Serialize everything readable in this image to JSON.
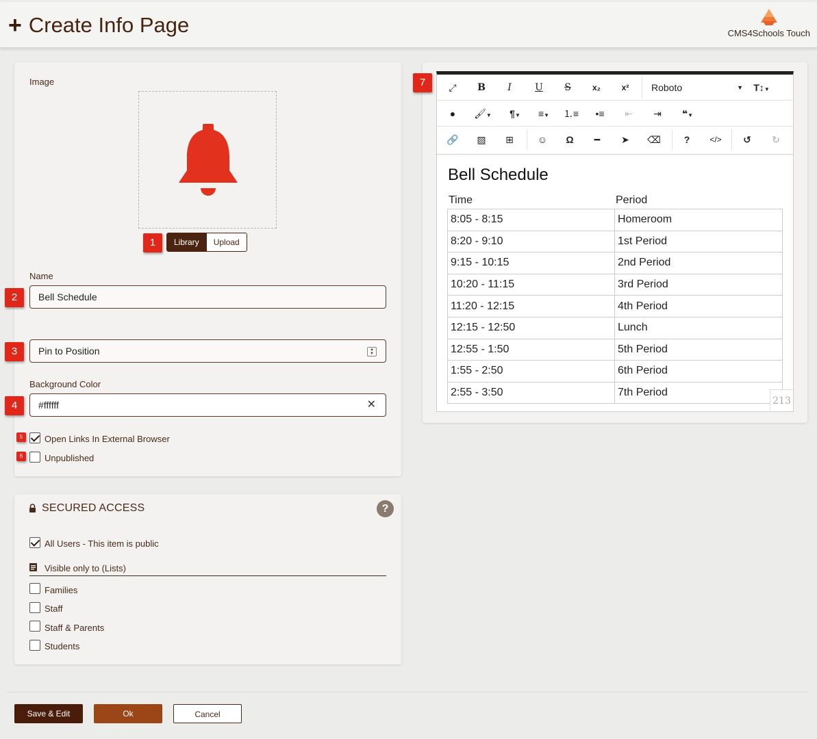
{
  "header": {
    "title": "Create Info Page",
    "brand": "CMS4Schools Touch"
  },
  "colors": {
    "accent": "#4a2410",
    "marker": "#e0271a",
    "bell": "#e2311c"
  },
  "form": {
    "image_label": "Image",
    "image_icon": "bell-icon",
    "library_label": "Library",
    "upload_label": "Upload",
    "name_label": "Name",
    "name_value": "Bell Schedule",
    "position_value": "Pin to Position",
    "bg_label": "Background Color",
    "bg_value": "#ffffff",
    "open_links_label": "Open Links In External Browser",
    "open_links_checked": true,
    "unpublished_label": "Unpublished",
    "unpublished_checked": false
  },
  "markers": [
    "1",
    "2",
    "3",
    "4",
    "5",
    "6",
    "7"
  ],
  "secured": {
    "title": "SECURED ACCESS",
    "help": "?",
    "all_users_label": "All Users - This item is public",
    "visible_label": "Visible only to (Lists)",
    "lists": [
      "Families",
      "Staff",
      "Staff & Parents",
      "Students"
    ]
  },
  "editor": {
    "font": "Roboto",
    "doc_title": "Bell Schedule",
    "col_time": "Time",
    "col_period": "Period",
    "rows": [
      [
        "8:05 - 8:15",
        "Homeroom"
      ],
      [
        "8:20 - 9:10",
        "1st Period"
      ],
      [
        "9:15 - 10:15",
        "2nd Period"
      ],
      [
        "10:20 - 11:15",
        "3rd Period"
      ],
      [
        "11:20 - 12:15",
        "4th Period"
      ],
      [
        "12:15 - 12:50",
        "Lunch"
      ],
      [
        "12:55 - 1:50",
        "5th Period"
      ],
      [
        "1:55 - 2:50",
        "6th Period"
      ],
      [
        "2:55 - 3:50",
        "7th Period"
      ]
    ],
    "char_count": "213"
  },
  "actions": {
    "save_edit": "Save & Edit",
    "ok": "Ok",
    "cancel": "Cancel"
  }
}
